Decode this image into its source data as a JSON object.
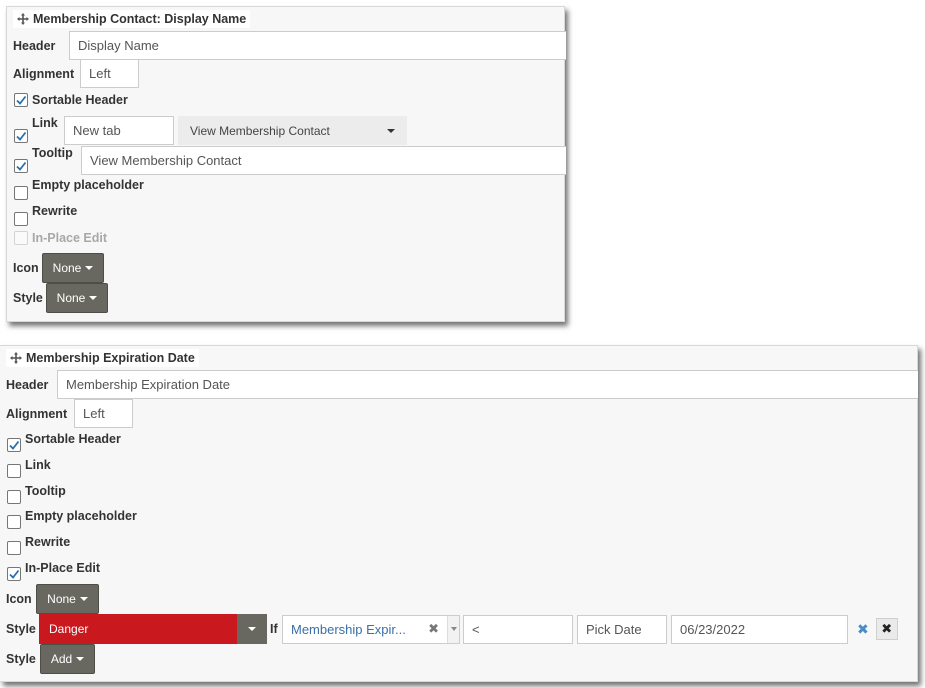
{
  "panel1": {
    "title": "Membership Contact: Display Name",
    "header": {
      "label": "Header",
      "value": "Display Name"
    },
    "alignment": {
      "label": "Alignment",
      "value": "Left"
    },
    "sortable": {
      "label": "Sortable Header",
      "checked": true
    },
    "link": {
      "label": "Link",
      "checked": true,
      "target_value": "New tab",
      "action_value": "View Membership Contact"
    },
    "tooltip": {
      "label": "Tooltip",
      "checked": true,
      "value": "View Membership Contact"
    },
    "empty_placeholder": {
      "label": "Empty placeholder",
      "checked": false
    },
    "rewrite": {
      "label": "Rewrite",
      "checked": false
    },
    "inplace_edit": {
      "label": "In-Place Edit",
      "checked": false,
      "disabled": true
    },
    "icon": {
      "label": "Icon",
      "value": "None"
    },
    "style": {
      "label": "Style",
      "value": "None"
    }
  },
  "panel2": {
    "title": "Membership Expiration Date",
    "header": {
      "label": "Header",
      "value": "Membership Expiration Date"
    },
    "alignment": {
      "label": "Alignment",
      "value": "Left"
    },
    "sortable": {
      "label": "Sortable Header",
      "checked": true
    },
    "link": {
      "label": "Link",
      "checked": false
    },
    "tooltip": {
      "label": "Tooltip",
      "checked": false
    },
    "empty_placeholder": {
      "label": "Empty placeholder",
      "checked": false
    },
    "rewrite": {
      "label": "Rewrite",
      "checked": false
    },
    "inplace_edit": {
      "label": "In-Place Edit",
      "checked": true
    },
    "icon": {
      "label": "Icon",
      "value": "None"
    },
    "style_rule": {
      "label": "Style",
      "style_value": "Danger",
      "if_label": "If",
      "field_value": "Membership Expir...",
      "operator_value": "<",
      "pick_date_value": "Pick Date",
      "date_value": "06/23/2022"
    },
    "style_add": {
      "label": "Style",
      "button": "Add"
    }
  },
  "colors": {
    "danger": "#c9191f",
    "dark_button": "#686860",
    "link_blue": "#3a6fa8",
    "checkbox_check": "#2a6fb0"
  },
  "icons": [
    "move-icon",
    "checkmark-icon",
    "caret-down-icon",
    "clear-x-icon",
    "remove-icon"
  ]
}
